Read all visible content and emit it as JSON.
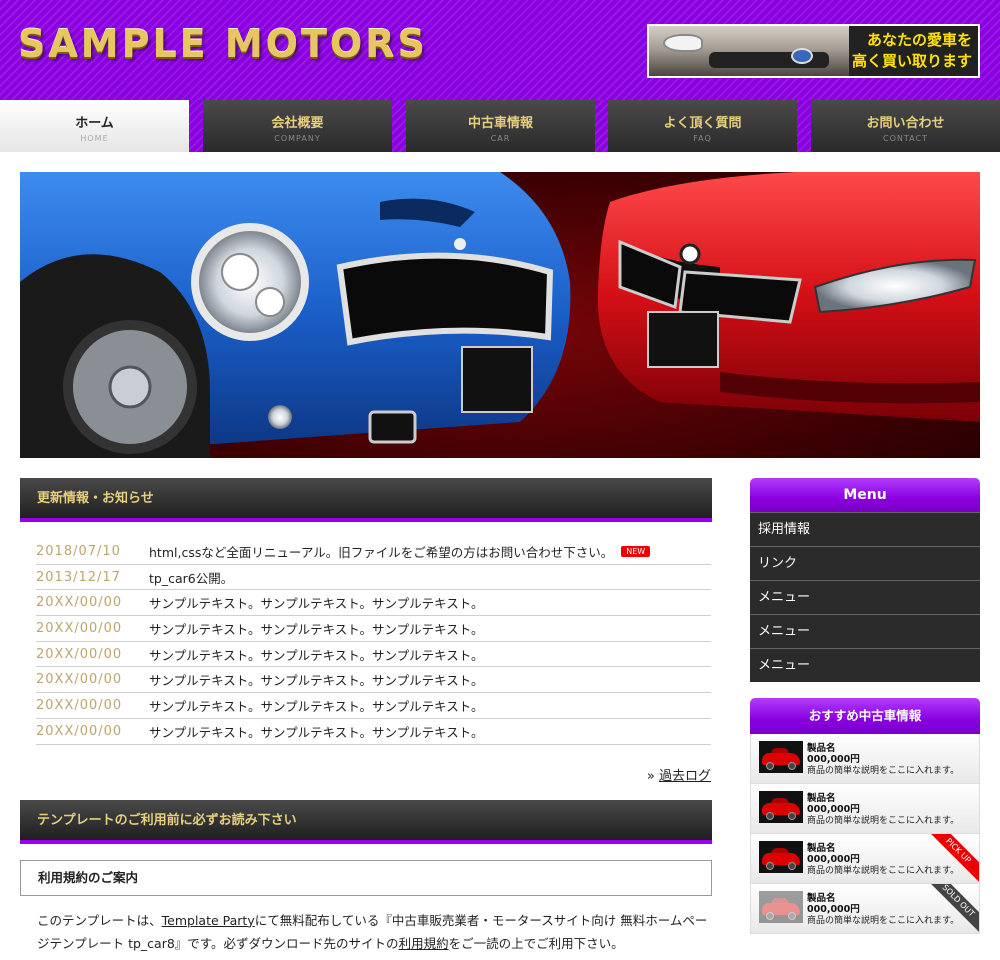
{
  "header": {
    "logo": "SAMPLE MOTORS",
    "banner_line1": "あなたの愛車を",
    "banner_line2": "高く買い取ります"
  },
  "nav": [
    {
      "label": "ホーム",
      "sub": "HOME"
    },
    {
      "label": "会社概要",
      "sub": "COMPANY"
    },
    {
      "label": "中古車情報",
      "sub": "CAR"
    },
    {
      "label": "よく頂く質問",
      "sub": "FAQ"
    },
    {
      "label": "お問い合わせ",
      "sub": "CONTACT"
    }
  ],
  "news": {
    "title": "更新情報・お知らせ",
    "items": [
      {
        "date": "2018/07/10",
        "text": "html,cssなど全面リニューアル。旧ファイルをご希望の方はお問い合わせ下さい。",
        "badge": "NEW"
      },
      {
        "date": "2013/12/17",
        "text": "tp_car6公開。"
      },
      {
        "date": "20XX/00/00",
        "text": "サンプルテキスト。サンプルテキスト。サンプルテキスト。"
      },
      {
        "date": "20XX/00/00",
        "text": "サンプルテキスト。サンプルテキスト。サンプルテキスト。"
      },
      {
        "date": "20XX/00/00",
        "text": "サンプルテキスト。サンプルテキスト。サンプルテキスト。"
      },
      {
        "date": "20XX/00/00",
        "text": "サンプルテキスト。サンプルテキスト。サンプルテキスト。"
      },
      {
        "date": "20XX/00/00",
        "text": "サンプルテキスト。サンプルテキスト。サンプルテキスト。"
      },
      {
        "date": "20XX/00/00",
        "text": "サンプルテキスト。サンプルテキスト。サンプルテキスト。"
      }
    ],
    "past_log_prefix": "»",
    "past_log": "過去ログ"
  },
  "section2": {
    "title": "テンプレートのご利用前に必ずお読み下さい",
    "terms_heading": "利用規約のご案内",
    "intro_1": "このテンプレートは、",
    "intro_link1": "Template Party",
    "intro_2": "にて無料配布している『中古車販売業者・モータースサイト向け 無料ホームページテンプレート tp_car8』です。必ずダウンロード先のサイトの",
    "intro_link2": "利用規約",
    "intro_3": "をご一読の上でご利用下さい。"
  },
  "sidebar": {
    "menu_title": "Menu",
    "menu_items": [
      "採用情報",
      "リンク",
      "メニュー",
      "メニュー",
      "メニュー"
    ],
    "reco_title": "おすすめ中古車情報",
    "cars": [
      {
        "name": "製品名",
        "price": "000,000円",
        "desc": "商品の簡単な説明をここに入れます。",
        "ribbon": ""
      },
      {
        "name": "製品名",
        "price": "000,000円",
        "desc": "商品の簡単な説明をここに入れます。",
        "ribbon": ""
      },
      {
        "name": "製品名",
        "price": "000,000円",
        "desc": "商品の簡単な説明をここに入れます。",
        "ribbon": "PICK UP"
      },
      {
        "name": "製品名",
        "price": "000,000円",
        "desc": "商品の簡単な説明をここに入れます。",
        "ribbon": "SOLD OUT"
      }
    ]
  },
  "colors": {
    "brand_purple": "#8a00e0",
    "nav_gold": "#e6cf7d",
    "date_gold": "#bda56c",
    "new_badge": "#ee0000"
  }
}
